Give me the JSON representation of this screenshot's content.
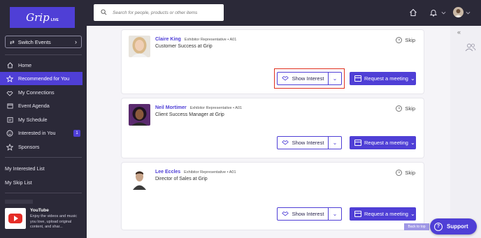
{
  "logo": {
    "main": "Grip",
    "sub": "LIVE"
  },
  "switch_events": {
    "label": "Switch Events"
  },
  "nav": [
    {
      "label": "Home",
      "icon": "home-icon"
    },
    {
      "label": "Recommended for You",
      "icon": "star-icon",
      "active": true
    },
    {
      "label": "My Connections",
      "icon": "handshake-icon"
    },
    {
      "label": "Event Agenda",
      "icon": "calendar-icon"
    },
    {
      "label": "My Schedule",
      "icon": "schedule-icon"
    },
    {
      "label": "Interested in You",
      "icon": "smiley-icon",
      "badge": "1"
    },
    {
      "label": "Sponsors",
      "icon": "star-outline-icon"
    }
  ],
  "links": {
    "interested_list": "My Interested List",
    "skip_list": "My Skip List"
  },
  "promo": {
    "title": "YouTube",
    "description": "Enjoy the videos and music you love, upload original content, and shar..."
  },
  "search": {
    "placeholder": "Search for people, products or other items"
  },
  "cards": [
    {
      "name": "Claire King",
      "role": "Exhibitor Representative • A01",
      "title": "Customer Success at Grip"
    },
    {
      "name": "Neil Mortimer",
      "role": "Exhibitor Representative • A01",
      "title": "Client Success Manager at Grip"
    },
    {
      "name": "Lee Eccles",
      "role": "Exhibitor Representative • A01",
      "title": "Director of Sales at Grip"
    }
  ],
  "actions": {
    "skip": "Skip",
    "show_interest": "Show Interest",
    "request_meeting": "Request a meeting"
  },
  "back_to_top": "Back to top",
  "support": "Support",
  "colors": {
    "accent": "#4f3fd6",
    "sidebar": "#2b2938",
    "highlight": "#e0301e"
  }
}
